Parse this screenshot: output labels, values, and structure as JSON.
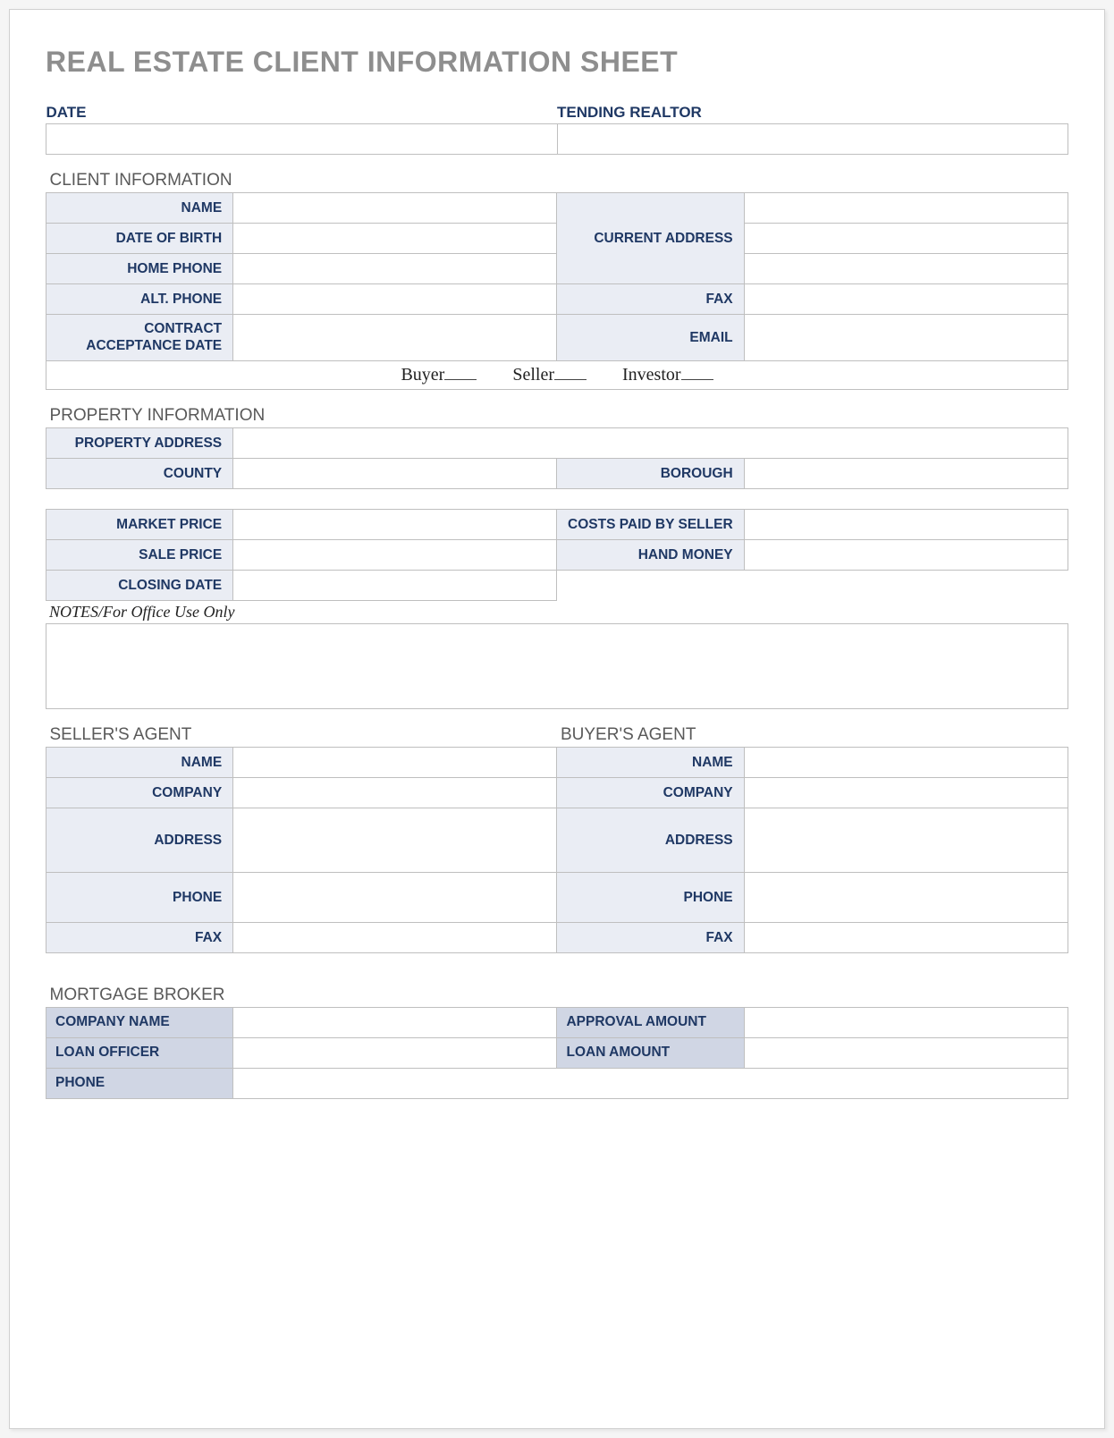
{
  "title": "REAL ESTATE CLIENT INFORMATION SHEET",
  "header": {
    "date_label": "DATE",
    "realtor_label": "TENDING REALTOR",
    "date_value": "",
    "realtor_value": ""
  },
  "client": {
    "section": "CLIENT INFORMATION",
    "name_label": "NAME",
    "name_value": "",
    "dob_label": "DATE OF BIRTH",
    "dob_value": "",
    "home_phone_label": "HOME PHONE",
    "home_phone_value": "",
    "alt_phone_label": "ALT. PHONE",
    "alt_phone_value": "",
    "contract_date_label": "CONTRACT ACCEPTANCE DATE",
    "contract_date_value": "",
    "current_address_label": "CURRENT ADDRESS",
    "current_address_value": "",
    "fax_label": "FAX",
    "fax_value": "",
    "email_label": "EMAIL",
    "email_value": "",
    "role_buyer": "Buyer",
    "role_seller": "Seller",
    "role_investor": "Investor"
  },
  "property": {
    "section": "PROPERTY INFORMATION",
    "address_label": "PROPERTY ADDRESS",
    "address_value": "",
    "county_label": "COUNTY",
    "county_value": "",
    "borough_label": "BOROUGH",
    "borough_value": "",
    "market_price_label": "MARKET PRICE",
    "market_price_value": "",
    "sale_price_label": "SALE PRICE",
    "sale_price_value": "",
    "closing_date_label": "CLOSING DATE",
    "closing_date_value": "",
    "costs_seller_label": "COSTS PAID BY SELLER",
    "costs_seller_value": "",
    "hand_money_label": "HAND MONEY",
    "hand_money_value": ""
  },
  "notes": {
    "label": "NOTES/For Office Use Only",
    "value": ""
  },
  "seller_agent": {
    "section": "SELLER'S AGENT",
    "name_label": "NAME",
    "name_value": "",
    "company_label": "COMPANY",
    "company_value": "",
    "address_label": "ADDRESS",
    "address_value": "",
    "phone_label": "PHONE",
    "phone_value": "",
    "fax_label": "FAX",
    "fax_value": ""
  },
  "buyer_agent": {
    "section": "BUYER'S AGENT",
    "name_label": "NAME",
    "name_value": "",
    "company_label": "COMPANY",
    "company_value": "",
    "address_label": "ADDRESS",
    "address_value": "",
    "phone_label": "PHONE",
    "phone_value": "",
    "fax_label": "FAX",
    "fax_value": ""
  },
  "broker": {
    "section": "MORTGAGE BROKER",
    "company_label": "COMPANY NAME",
    "company_value": "",
    "officer_label": "LOAN OFFICER",
    "officer_value": "",
    "phone_label": "PHONE",
    "phone_value": "",
    "approval_label": "APPROVAL AMOUNT",
    "approval_value": "",
    "loan_amount_label": "LOAN AMOUNT",
    "loan_amount_value": ""
  }
}
